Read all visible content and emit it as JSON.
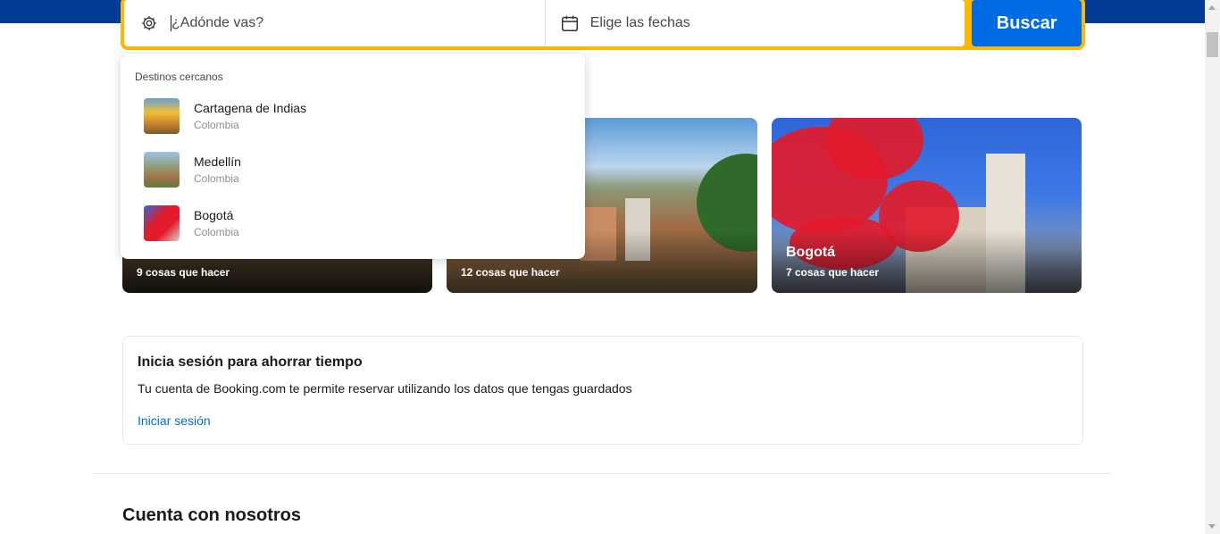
{
  "search": {
    "destination_placeholder": "¿Adónde vas?",
    "dates_label": "Elige las fechas",
    "button_label": "Buscar",
    "destination_icon": "sightseeing-icon",
    "dates_icon": "calendar-icon"
  },
  "dropdown": {
    "heading": "Destinos cercanos",
    "items": [
      {
        "name": "Cartagena de Indias",
        "country": "Colombia"
      },
      {
        "name": "Medellín",
        "country": "Colombia"
      },
      {
        "name": "Bogotá",
        "country": "Colombia"
      }
    ]
  },
  "cards": [
    {
      "title": "",
      "subtitle": "9 cosas que hacer"
    },
    {
      "title": "",
      "subtitle": "12 cosas que hacer"
    },
    {
      "title": "Bogotá",
      "subtitle": "7 cosas que hacer"
    }
  ],
  "signin": {
    "title": "Inicia sesión para ahorrar tiempo",
    "text": "Tu cuenta de Booking.com te permite reservar utilizando los datos que tengas guardados",
    "link": "Iniciar sesión"
  },
  "section": {
    "title": "Cuenta con nosotros"
  },
  "colors": {
    "brand_blue": "#003b95",
    "search_border": "#ffb700",
    "button_blue": "#006ce4"
  }
}
